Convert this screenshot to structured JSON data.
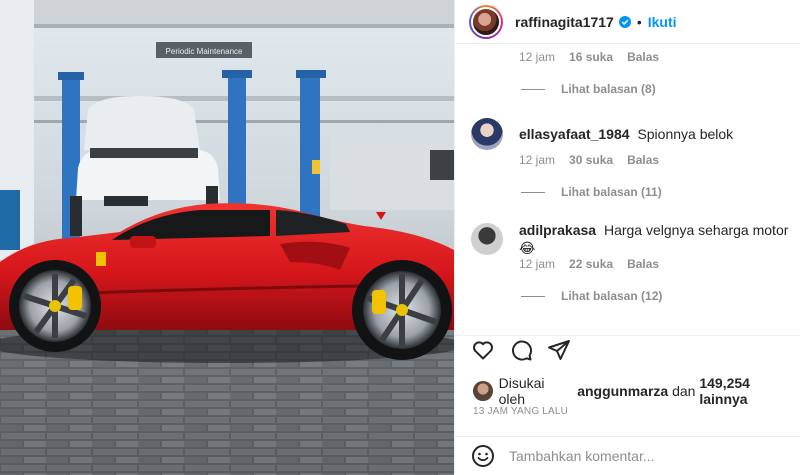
{
  "post": {
    "username": "raffinagita1717",
    "separator": "•",
    "follow_label": "Ikuti",
    "image_sign_text": "Periodic Maintenance"
  },
  "comments": [
    {
      "user": "",
      "text": "",
      "time": "12 jam",
      "likes": "16 suka",
      "reply_label": "Balas",
      "view_replies": "Lihat balasan (8)"
    },
    {
      "user": "ellasyafaat_1984",
      "text": "Spionnya belok",
      "time": "12 jam",
      "likes": "30 suka",
      "reply_label": "Balas",
      "view_replies": "Lihat balasan (11)"
    },
    {
      "user": "adilprakasa",
      "text": "Harga velgnya seharga motor😂",
      "time": "12 jam",
      "likes": "22 suka",
      "reply_label": "Balas",
      "view_replies": "Lihat balasan (12)"
    }
  ],
  "likes_summary": {
    "prefix": "Disukai oleh",
    "user": "anggunmarza",
    "connector": "dan",
    "count": "149,254 lainnya"
  },
  "time_ago": "13 JAM YANG LALU",
  "add_comment": {
    "placeholder": "Tambahkan komentar..."
  },
  "icons": [
    "verified-icon",
    "heart-icon",
    "comment-icon",
    "share-icon",
    "emoji-icon"
  ],
  "colors": {
    "accent": "#0095f6",
    "muted": "#8e8e8e",
    "car_red": "#d5161b"
  }
}
